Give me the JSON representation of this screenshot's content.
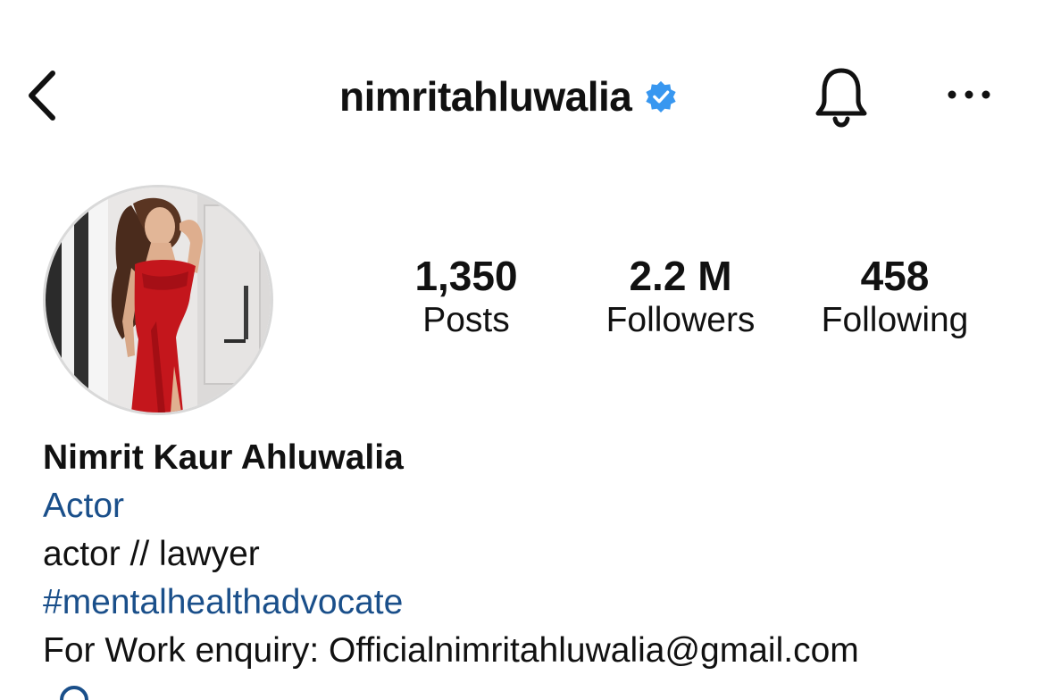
{
  "header": {
    "username": "nimritahluwalia",
    "verified": true,
    "back_icon": "chevron-left-icon",
    "bell_icon": "bell-icon",
    "more_icon": "ellipsis-icon",
    "verified_color": "#3897f0"
  },
  "stats": {
    "posts": {
      "value": "1,350",
      "label": "Posts"
    },
    "followers": {
      "value": "2.2 M",
      "label": "Followers"
    },
    "following": {
      "value": "458",
      "label": "Following"
    }
  },
  "bio": {
    "name": "Nimrit Kaur Ahluwalia",
    "category": "Actor",
    "description": "actor // lawyer",
    "hashtag": "#mentalhealthadvocate",
    "contact": "For Work enquiry: Officialnimritahluwalia@gmail.com"
  },
  "colors": {
    "link_blue": "#1a4f8a",
    "text": "#111111",
    "avatar_dress": "#c4161c"
  }
}
